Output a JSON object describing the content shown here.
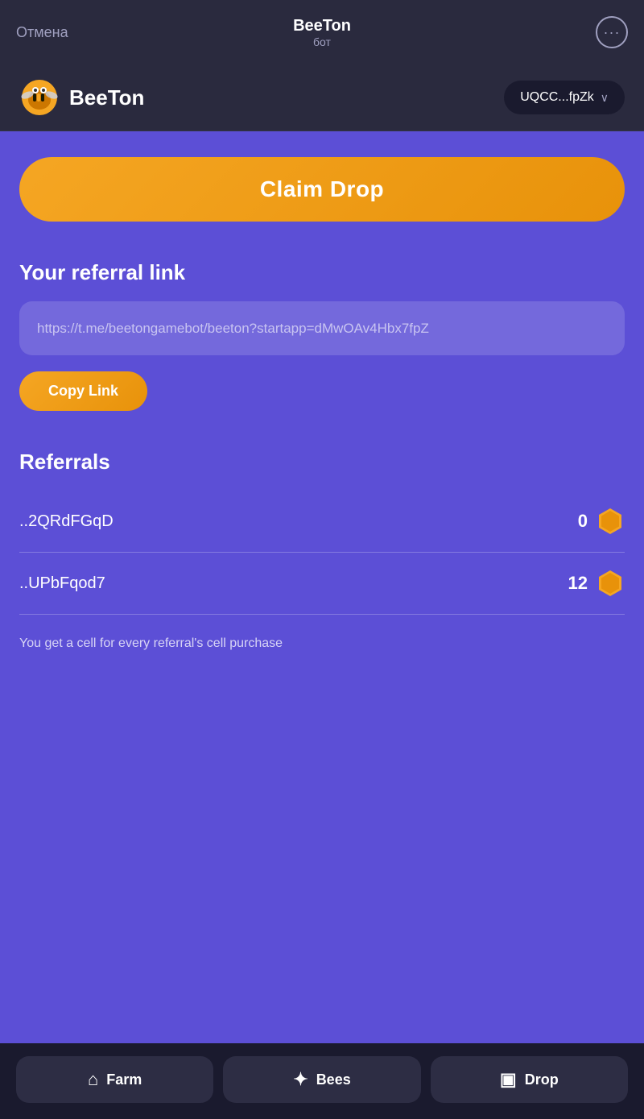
{
  "topbar": {
    "cancel_label": "Отмена",
    "title": "BeeTon",
    "subtitle": "бот",
    "menu_dots": "···"
  },
  "header": {
    "app_name": "BeeTon",
    "wallet_address": "UQCC...fpZk",
    "chevron": "∨"
  },
  "main": {
    "claim_drop_label": "Claim Drop",
    "referral_section_title": "Your referral link",
    "referral_link": "https://t.me/beetongamebot/beeton?startapp=dMwOAv4Hbx7fpZ",
    "copy_link_label": "Copy Link",
    "referrals_title": "Referrals",
    "referrals": [
      {
        "name": "..2QRdFGqD",
        "count": "0"
      },
      {
        "name": "..UPbFqod7",
        "count": "12"
      }
    ],
    "info_text": "You get a cell for every referral's cell purchase"
  },
  "bottom_nav": {
    "farm_label": "Farm",
    "bees_label": "Bees",
    "drop_label": "Drop",
    "farm_icon": "⌂",
    "bees_icon": "✦",
    "drop_icon": "▣"
  }
}
